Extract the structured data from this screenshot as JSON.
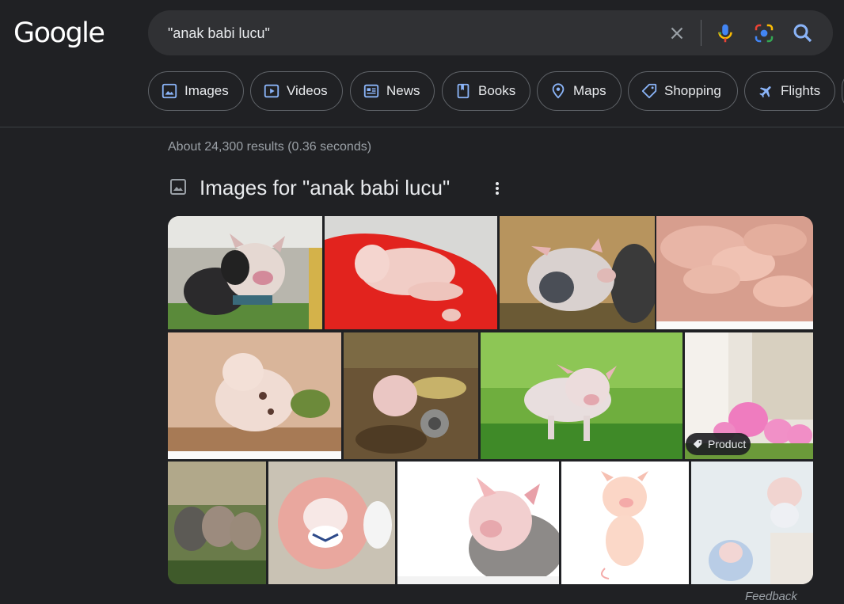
{
  "logo": "Google",
  "search": {
    "query": "\"anak babi lucu\""
  },
  "chips": [
    {
      "label": "Images",
      "icon": "image-icon"
    },
    {
      "label": "Videos",
      "icon": "play-icon"
    },
    {
      "label": "News",
      "icon": "news-icon"
    },
    {
      "label": "Books",
      "icon": "book-icon"
    },
    {
      "label": "Maps",
      "icon": "map-pin-icon"
    },
    {
      "label": "Shopping",
      "icon": "tag-icon"
    },
    {
      "label": "Flights",
      "icon": "airplane-icon"
    }
  ],
  "result_stats": "About 24,300 results (0.36 seconds)",
  "images_heading": "Images for \"anak babi lucu\"",
  "product_badge": "Product",
  "feedback": "Feedback",
  "image_tiles": [
    {
      "name": "piglet-black-white"
    },
    {
      "name": "piglet-red-blanket"
    },
    {
      "name": "piglet-spotted-straw"
    },
    {
      "name": "piglets-pile-shutterstock"
    },
    {
      "name": "piglet-wood-wall-shutterstock"
    },
    {
      "name": "piglet-wheelbarrow"
    },
    {
      "name": "piglet-grass"
    },
    {
      "name": "pink-pig-plush-product"
    },
    {
      "name": "piglets-forest"
    },
    {
      "name": "pig-mousepad"
    },
    {
      "name": "pig-illustration-shutterstock"
    },
    {
      "name": "cartoon-pig"
    },
    {
      "name": "pig-plush-toys"
    }
  ],
  "colors": {
    "background": "#202124",
    "searchbar": "#303134",
    "chip_border": "#5f6368",
    "text": "#e8eaed",
    "muted_text": "#9aa0a6"
  }
}
